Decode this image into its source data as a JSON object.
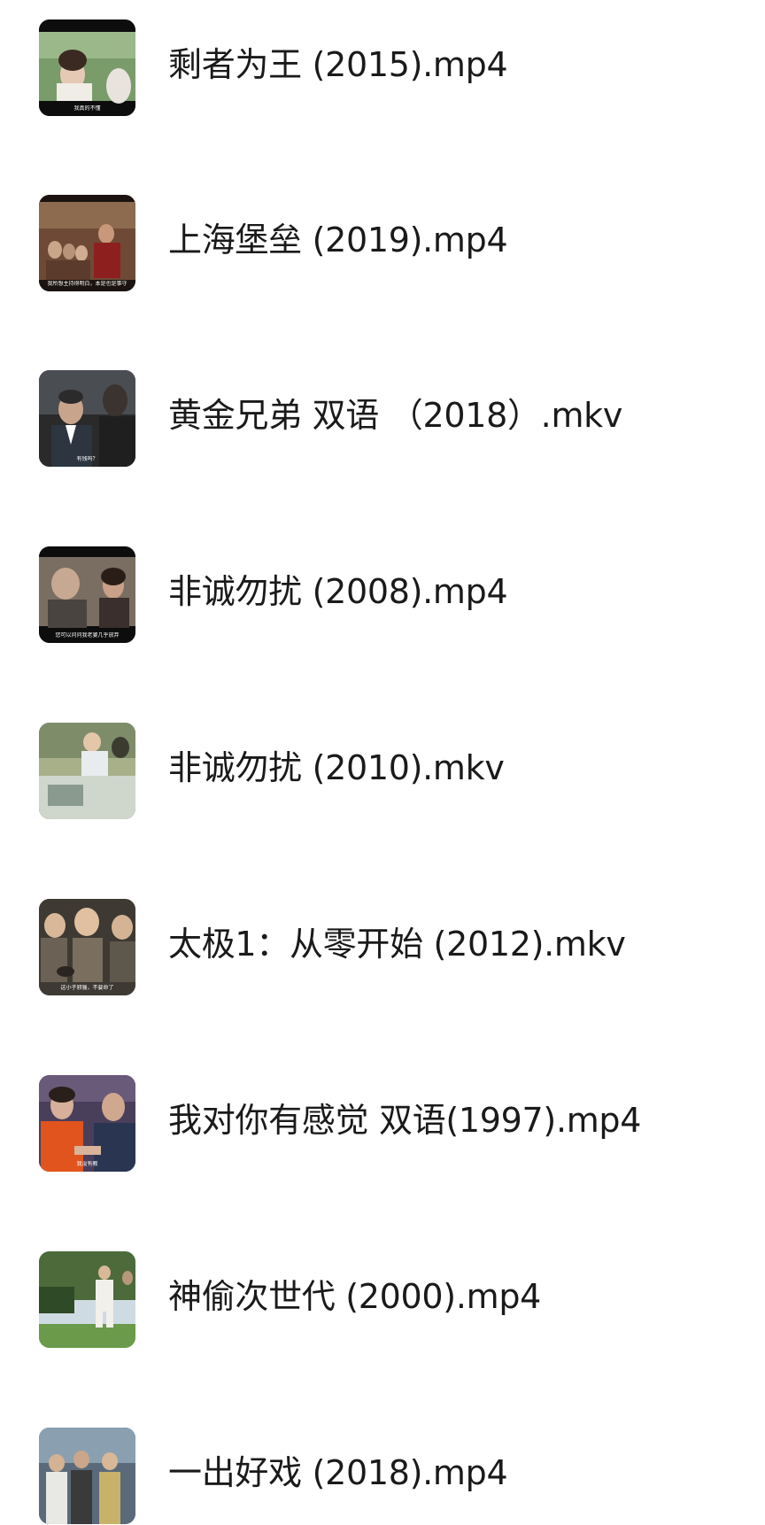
{
  "files": [
    {
      "name": "剩者为王 (2015).mp4",
      "thumbnail_icon": "video-thumbnail-icon",
      "subtitle": "我真的不懂"
    },
    {
      "name": "上海堡垒 (2019).mp4",
      "thumbnail_icon": "video-thumbnail-icon",
      "subtitle": "我所想主持得明白，本是也是事守"
    },
    {
      "name": "黄金兄弟 双语 （2018）.mkv",
      "thumbnail_icon": "video-thumbnail-icon",
      "subtitle": "有钱吗？"
    },
    {
      "name": "非诚勿扰 (2008).mp4",
      "thumbnail_icon": "video-thumbnail-icon",
      "subtitle": "您可以问问我老婆几乎放弃"
    },
    {
      "name": "非诚勿扰 (2010).mkv",
      "thumbnail_icon": "video-thumbnail-icon",
      "subtitle": ""
    },
    {
      "name": "太极1：从零开始 (2012).mkv",
      "thumbnail_icon": "video-thumbnail-icon",
      "subtitle": "这小子邪骚，不要命了"
    },
    {
      "name": "我对你有感觉 双语(1997).mp4",
      "thumbnail_icon": "video-thumbnail-icon",
      "subtitle": "我没有教"
    },
    {
      "name": "神偷次世代 (2000).mp4",
      "thumbnail_icon": "video-thumbnail-icon",
      "subtitle": ""
    },
    {
      "name": "一出好戏 (2018).mp4",
      "thumbnail_icon": "video-thumbnail-icon",
      "subtitle": ""
    }
  ]
}
